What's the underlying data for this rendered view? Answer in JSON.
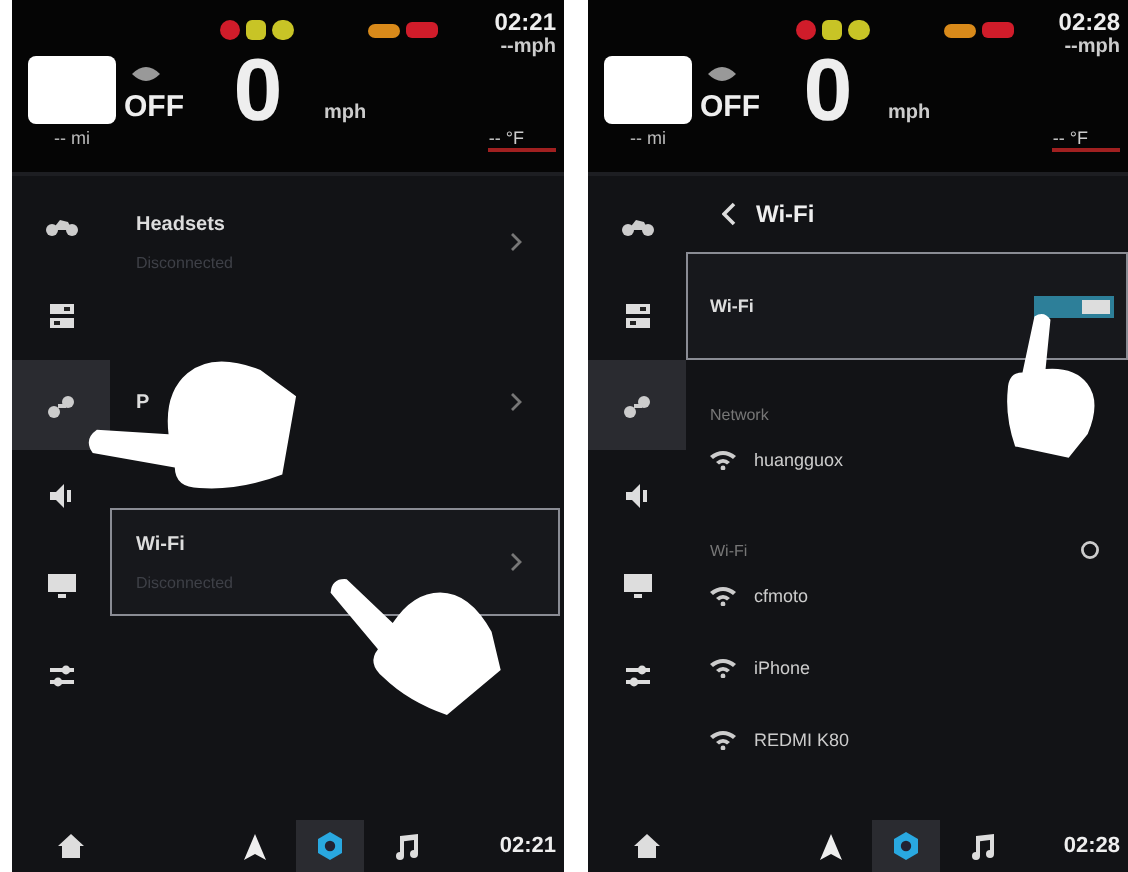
{
  "screens": [
    {
      "status": {
        "time": "02:21",
        "cruise": "OFF",
        "speed": "0",
        "speed_unit": "mph",
        "range": "-- mi",
        "top_speed": "--mph",
        "temperature": "-- °F"
      },
      "sidebar": [
        {
          "selected": false
        },
        {
          "selected": false
        },
        {
          "selected": true
        },
        {
          "selected": false
        },
        {
          "selected": false
        },
        {
          "selected": false
        }
      ],
      "page": {
        "kind": "menu",
        "items": [
          {
            "title": "Headsets",
            "subtitle": "Disconnected",
            "highlighted": false
          },
          {
            "title": "P",
            "highlighted": false
          },
          {
            "title": "Wi-Fi",
            "subtitle": "Disconnected",
            "highlighted": true
          }
        ]
      },
      "bottom_nav": [
        {
          "selected": false
        },
        {
          "selected": false
        },
        {
          "selected": true
        },
        {
          "selected": false
        }
      ],
      "clock": "02:21",
      "hands": [
        {
          "kind": "sidebar"
        },
        {
          "kind": "item"
        }
      ]
    },
    {
      "status": {
        "time": "02:28",
        "cruise": "OFF",
        "speed": "0",
        "speed_unit": "mph",
        "range": "-- mi",
        "top_speed": "--mph",
        "temperature": "-- °F"
      },
      "sidebar": [
        {
          "selected": false
        },
        {
          "selected": false
        },
        {
          "selected": true
        },
        {
          "selected": false
        },
        {
          "selected": false
        },
        {
          "selected": false
        }
      ],
      "page": {
        "kind": "wifi",
        "title": "Wi-Fi",
        "toggle": {
          "label": "Wi-Fi",
          "on": true
        },
        "sections": [
          {
            "heading": "Network",
            "refresh": false,
            "networks": [
              "huangguox"
            ]
          },
          {
            "heading": "Wi-Fi",
            "refresh": true,
            "networks": [
              "cfmoto",
              "iPhone",
              "REDMI K80"
            ]
          }
        ]
      },
      "bottom_nav": [
        {
          "selected": false
        },
        {
          "selected": false
        },
        {
          "selected": true
        },
        {
          "selected": false
        }
      ],
      "clock": "02:28",
      "hands": [
        {
          "kind": "toggle"
        }
      ]
    }
  ]
}
